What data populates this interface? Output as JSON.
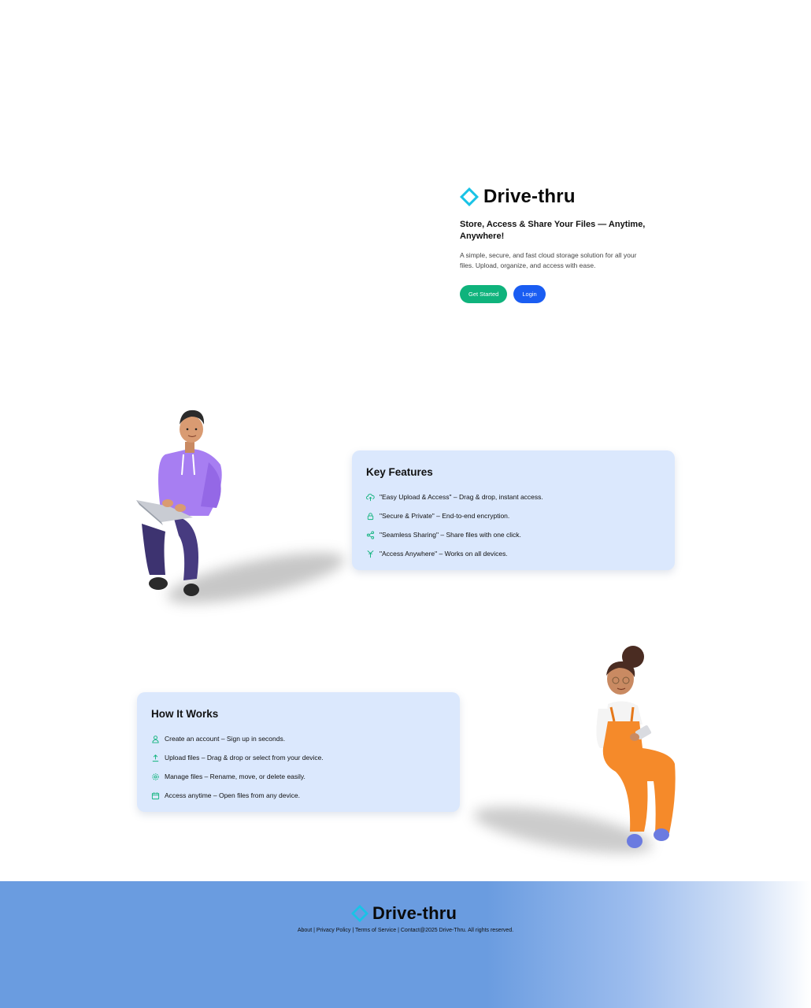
{
  "brand": {
    "name": "Drive-thru",
    "accent": "#19c3e6"
  },
  "hero": {
    "headline": "Store, Access & Share Your Files — Anytime, Anywhere!",
    "description": "A simple, secure, and fast cloud storage solution for all your files. Upload, organize, and access with ease.",
    "get_started_label": "Get Started",
    "login_label": "Login",
    "get_started_color": "#0fb37c",
    "login_color": "#1a5df2"
  },
  "features": {
    "title": "Key Features",
    "items": [
      {
        "icon": "cloud-upload-icon",
        "text": "\"Easy Upload & Access\" – Drag & drop, instant access."
      },
      {
        "icon": "lock-icon",
        "text": "\"Secure & Private\" – End-to-end encryption."
      },
      {
        "icon": "share-icon",
        "text": "\"Seamless Sharing\" – Share files with one click."
      },
      {
        "icon": "signal-icon",
        "text": "\"Access Anywhere\" – Works on all devices."
      }
    ]
  },
  "how_it_works": {
    "title": "How It Works",
    "items": [
      {
        "icon": "user-icon",
        "text": "Create an account – Sign up in seconds."
      },
      {
        "icon": "upload-icon",
        "text": "Upload files – Drag & drop or select from your device."
      },
      {
        "icon": "gear-icon",
        "text": "Manage files – Rename, move, or delete easily."
      },
      {
        "icon": "calendar-icon",
        "text": "Access anytime – Open files from any device."
      }
    ]
  },
  "footer": {
    "brand": "Drive-thru",
    "links": [
      "About",
      "Privacy Policy",
      "Terms of Service",
      "Contact"
    ],
    "separator": " | ",
    "copyright": "@2025 Drive-Thru. All rights reserved."
  }
}
